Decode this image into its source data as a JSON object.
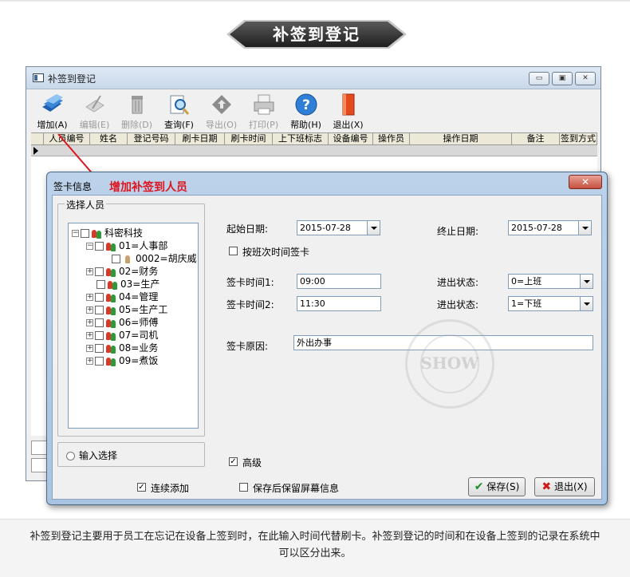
{
  "banner": {
    "title": "补签到登记"
  },
  "main_window": {
    "title": "补签到登记",
    "toolbar": [
      {
        "icon": "add-cards-icon",
        "label": "增加(A)",
        "enabled": true
      },
      {
        "icon": "edit-icon",
        "label": "编辑(E)",
        "enabled": false
      },
      {
        "icon": "trash-icon",
        "label": "删除(D)",
        "enabled": false
      },
      {
        "icon": "search-icon",
        "label": "查询(F)",
        "enabled": true
      },
      {
        "icon": "export-icon",
        "label": "导出(O)",
        "enabled": false
      },
      {
        "icon": "printer-icon",
        "label": "打印(P)",
        "enabled": false
      },
      {
        "icon": "help-icon",
        "label": "帮助(H)",
        "enabled": true
      },
      {
        "icon": "exit-door-icon",
        "label": "退出(X)",
        "enabled": true
      }
    ],
    "columns": [
      "人员编号",
      "姓名",
      "登记号码",
      "刷卡日期",
      "刷卡时间",
      "上下班标志",
      "设备编号",
      "操作员",
      "操作日期",
      "备注",
      "签到方式"
    ]
  },
  "annotation": {
    "text": "增加补签到人员"
  },
  "dialog": {
    "title": "签卡信息",
    "select_group_title": "选择人员",
    "tree": [
      {
        "label": "科密科技",
        "level": 0,
        "expander": "−"
      },
      {
        "label": "01=人事部",
        "level": 1,
        "expander": "−"
      },
      {
        "label": "0002=胡庆威",
        "level": 2,
        "expander": ""
      },
      {
        "label": "02=财务",
        "level": 1,
        "expander": "+"
      },
      {
        "label": "03=生产",
        "level": 1,
        "expander": ""
      },
      {
        "label": "04=管理",
        "level": 1,
        "expander": "+"
      },
      {
        "label": "05=生产工",
        "level": 1,
        "expander": "+"
      },
      {
        "label": "06=师傅",
        "level": 1,
        "expander": "+"
      },
      {
        "label": "07=司机",
        "level": 1,
        "expander": "+"
      },
      {
        "label": "08=业务",
        "level": 1,
        "expander": "+"
      },
      {
        "label": "09=煮饭",
        "level": 1,
        "expander": "+"
      }
    ],
    "input_select_label": "输入选择",
    "start_date_label": "起始日期:",
    "start_date": "2015-07-28",
    "end_date_label": "终止日期:",
    "end_date": "2015-07-28",
    "by_shift_label": "按班次时间签卡",
    "time1_label": "签卡时间1:",
    "time1": "09:00",
    "time2_label": "签卡时间2:",
    "time2": "11:30",
    "status1_label": "进出状态:",
    "status1": "0=上班",
    "status2_label": "进出状态:",
    "status2": "1=下班",
    "reason_label": "签卡原因:",
    "reason": "外出办事",
    "advanced_label": "高级",
    "continuous_add_label": "连续添加",
    "keep_info_label": "保存后保留屏幕信息",
    "save_label": "保存(S)",
    "exit_label": "退出(X)"
  },
  "watermark": {
    "text": "SHOW"
  },
  "caption": "补签到登记主要用于员工在忘记在设备上签到时，在此输入时间代替刷卡。补签到登记的时间和在设备上签到的记录在系统中可以区分出来。"
}
